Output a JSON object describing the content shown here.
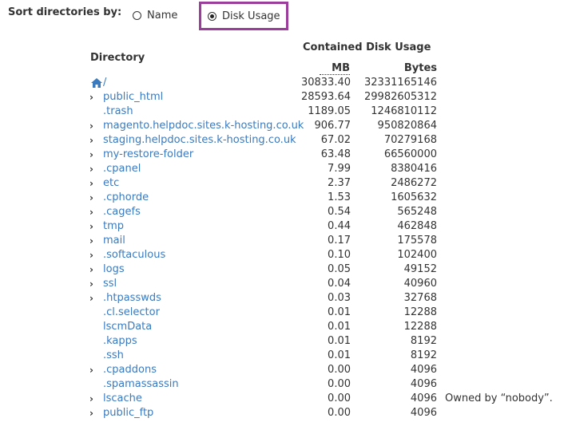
{
  "sort": {
    "label": "Sort directories by:",
    "options": [
      {
        "label": "Name",
        "selected": false
      },
      {
        "label": "Disk Usage",
        "selected": true
      }
    ],
    "highlight_color": "#9b3e9b"
  },
  "table": {
    "header_group": "Contained Disk Usage",
    "col_directory": "Directory",
    "col_mb": "MB",
    "col_bytes": "Bytes",
    "link_color": "#3a7abf",
    "rows": [
      {
        "name": "/",
        "mb": "30833.40",
        "bytes": "32331165146",
        "expandable": false,
        "home_icon": true
      },
      {
        "name": "public_html",
        "mb": "28593.64",
        "bytes": "29982605312",
        "expandable": true
      },
      {
        "name": ".trash",
        "mb": "1189.05",
        "bytes": "1246810112",
        "expandable": false
      },
      {
        "name": "magento.helpdoc.sites.k-hosting.co.uk",
        "mb": "906.77",
        "bytes": "950820864",
        "expandable": true
      },
      {
        "name": "staging.helpdoc.sites.k-hosting.co.uk",
        "mb": "67.02",
        "bytes": "70279168",
        "expandable": true
      },
      {
        "name": "my-restore-folder",
        "mb": "63.48",
        "bytes": "66560000",
        "expandable": true
      },
      {
        "name": ".cpanel",
        "mb": "7.99",
        "bytes": "8380416",
        "expandable": true
      },
      {
        "name": "etc",
        "mb": "2.37",
        "bytes": "2486272",
        "expandable": true
      },
      {
        "name": ".cphorde",
        "mb": "1.53",
        "bytes": "1605632",
        "expandable": true
      },
      {
        "name": ".cagefs",
        "mb": "0.54",
        "bytes": "565248",
        "expandable": true
      },
      {
        "name": "tmp",
        "mb": "0.44",
        "bytes": "462848",
        "expandable": true
      },
      {
        "name": "mail",
        "mb": "0.17",
        "bytes": "175578",
        "expandable": true
      },
      {
        "name": ".softaculous",
        "mb": "0.10",
        "bytes": "102400",
        "expandable": true
      },
      {
        "name": "logs",
        "mb": "0.05",
        "bytes": "49152",
        "expandable": true
      },
      {
        "name": "ssl",
        "mb": "0.04",
        "bytes": "40960",
        "expandable": true
      },
      {
        "name": ".htpasswds",
        "mb": "0.03",
        "bytes": "32768",
        "expandable": true
      },
      {
        "name": ".cl.selector",
        "mb": "0.01",
        "bytes": "12288",
        "expandable": false
      },
      {
        "name": "lscmData",
        "mb": "0.01",
        "bytes": "12288",
        "expandable": false
      },
      {
        "name": ".kapps",
        "mb": "0.01",
        "bytes": "8192",
        "expandable": false
      },
      {
        "name": ".ssh",
        "mb": "0.01",
        "bytes": "8192",
        "expandable": false
      },
      {
        "name": ".cpaddons",
        "mb": "0.00",
        "bytes": "4096",
        "expandable": true
      },
      {
        "name": ".spamassassin",
        "mb": "0.00",
        "bytes": "4096",
        "expandable": false
      },
      {
        "name": "lscache",
        "mb": "0.00",
        "bytes": "4096",
        "expandable": true,
        "note": "Owned by “nobody”."
      },
      {
        "name": "public_ftp",
        "mb": "0.00",
        "bytes": "4096",
        "expandable": true
      }
    ]
  }
}
